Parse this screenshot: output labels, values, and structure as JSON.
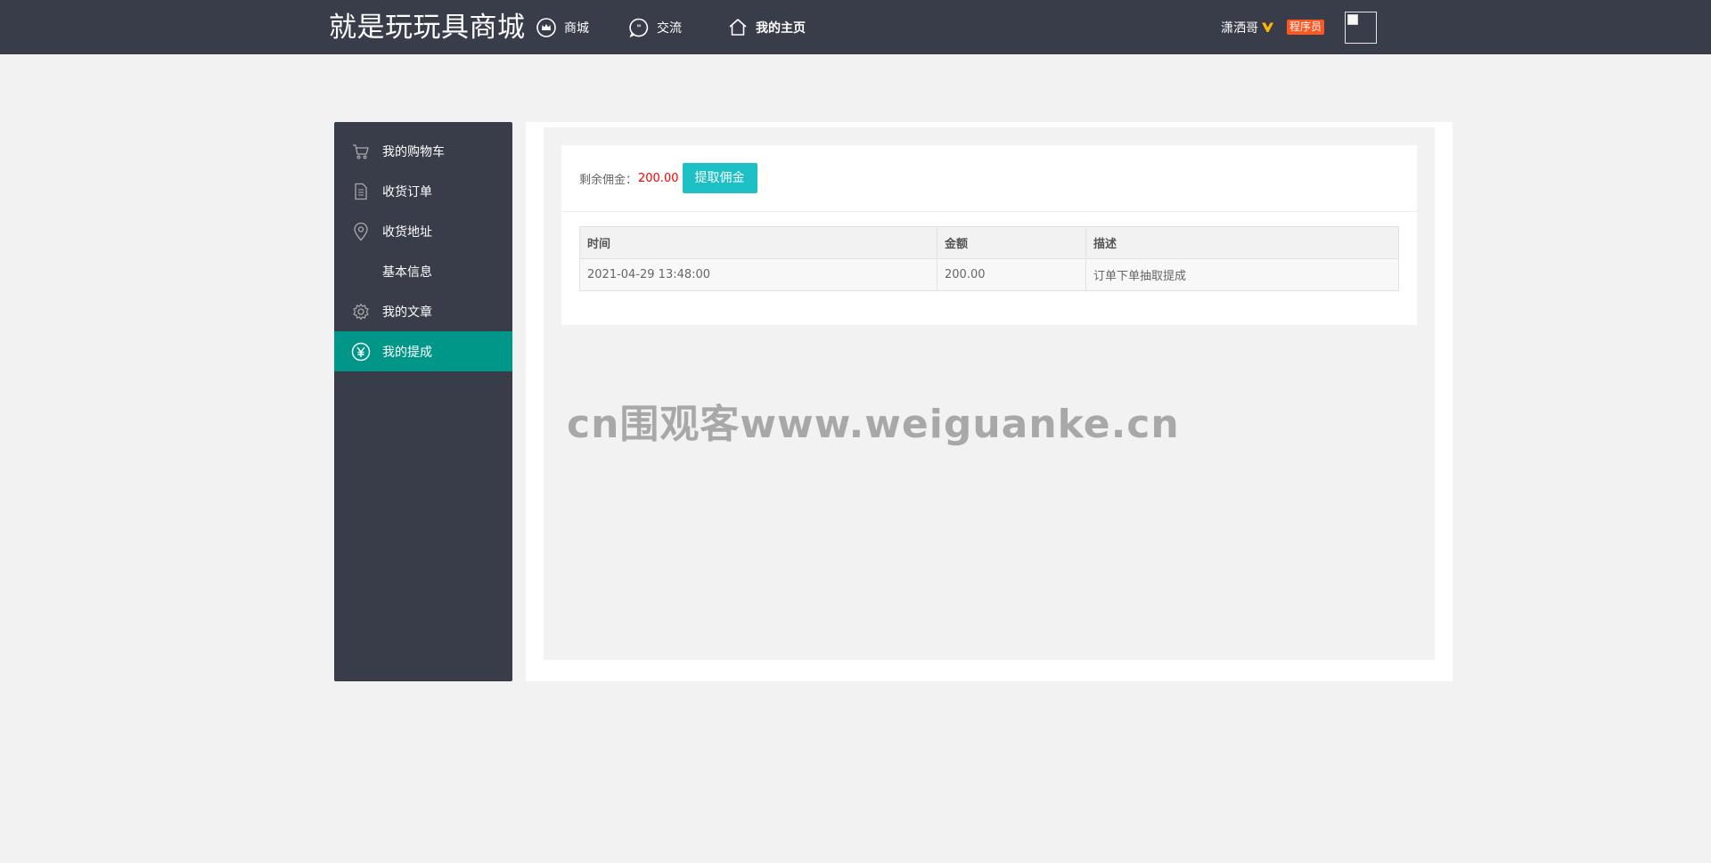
{
  "header": {
    "logo": "就是玩玩具商城",
    "nav": [
      {
        "label": "商城",
        "icon": "crown-icon"
      },
      {
        "label": "交流",
        "icon": "chat-icon"
      },
      {
        "label": "我的主页",
        "icon": "home-icon"
      }
    ],
    "user": {
      "name": "潇洒哥",
      "vip_icon": "vip-v-icon",
      "role": "程序员"
    }
  },
  "sidebar": {
    "items": [
      {
        "label": "我的购物车",
        "icon": "cart-icon"
      },
      {
        "label": "收货订单",
        "icon": "document-icon"
      },
      {
        "label": "收货地址",
        "icon": "location-pin-icon"
      },
      {
        "label": "基本信息",
        "icon": ""
      },
      {
        "label": "我的文章",
        "icon": "gear-icon"
      },
      {
        "label": "我的提成",
        "icon": "yen-icon"
      }
    ],
    "active_index": 5
  },
  "commission": {
    "balance_label": "剩余佣金：",
    "balance_value": "200.00",
    "withdraw_button": "提取佣金"
  },
  "table": {
    "headers": [
      "时间",
      "金额",
      "描述"
    ],
    "rows": [
      [
        "2021-04-29 13:48:00",
        "200.00",
        "订单下单抽取提成"
      ]
    ]
  },
  "watermark": "cn围观客www.weiguanke.cn",
  "colors": {
    "header_bg": "#393d49",
    "active_menu": "#009688",
    "button": "#1cc0c5",
    "badge": "#ff5722",
    "balance": "#ff0000"
  }
}
